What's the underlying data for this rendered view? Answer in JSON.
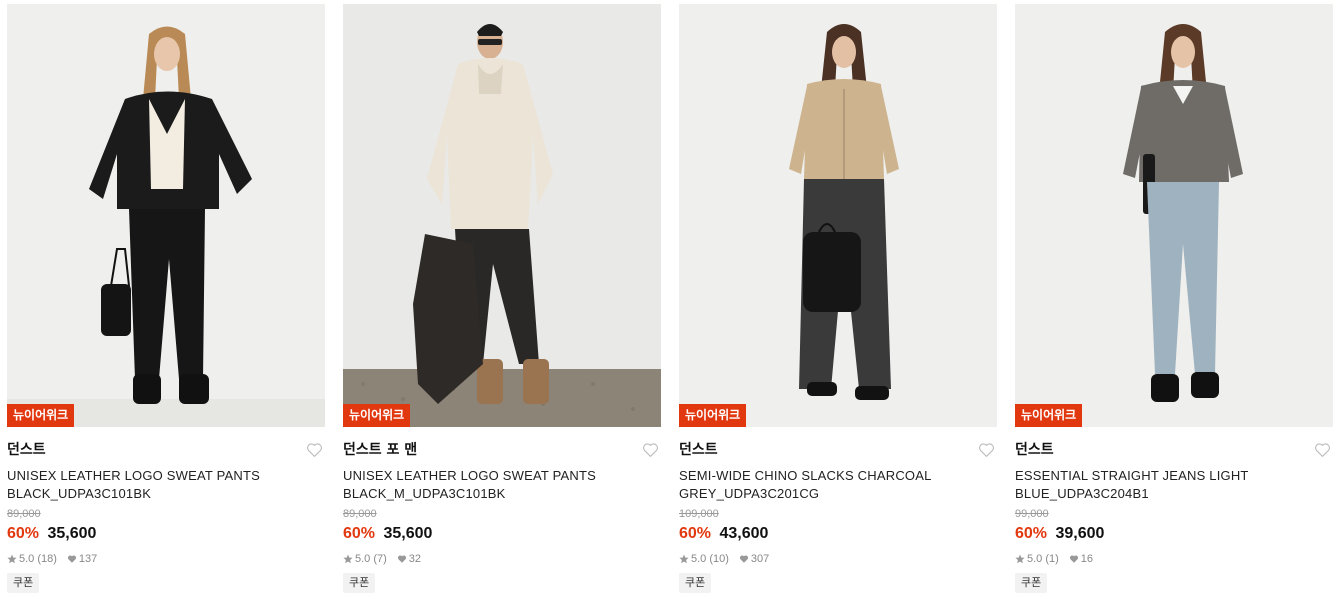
{
  "products": [
    {
      "tag": "뉴이어위크",
      "brand": "던스트",
      "name": "UNISEX LEATHER LOGO SWEAT PANTS BLACK_UDPA3C101BK",
      "original_price": "89,000",
      "discount": "60%",
      "price": "35,600",
      "rating": "5.0 (18)",
      "likes": "137",
      "coupon": "쿠폰"
    },
    {
      "tag": "뉴이어위크",
      "brand": "던스트 포 맨",
      "name": "UNISEX LEATHER LOGO SWEAT PANTS BLACK_M_UDPA3C101BK",
      "original_price": "89,000",
      "discount": "60%",
      "price": "35,600",
      "rating": "5.0 (7)",
      "likes": "32",
      "coupon": "쿠폰"
    },
    {
      "tag": "뉴이어위크",
      "brand": "던스트",
      "name": "SEMI-WIDE CHINO SLACKS CHARCOAL GREY_UDPA3C201CG",
      "original_price": "109,000",
      "discount": "60%",
      "price": "43,600",
      "rating": "5.0 (10)",
      "likes": "307",
      "coupon": "쿠폰"
    },
    {
      "tag": "뉴이어위크",
      "brand": "던스트",
      "name": "ESSENTIAL STRAIGHT JEANS LIGHT BLUE_UDPA3C204B1",
      "original_price": "99,000",
      "discount": "60%",
      "price": "39,600",
      "rating": "5.0 (1)",
      "likes": "16",
      "coupon": "쿠폰"
    }
  ],
  "colors": {
    "tag_bg": "#e2380f",
    "discount": "#e2380f",
    "muted": "#888888"
  },
  "icons": {
    "wishlist": "heart-outline-icon",
    "rating": "star-icon",
    "likes": "heart-filled-icon"
  }
}
